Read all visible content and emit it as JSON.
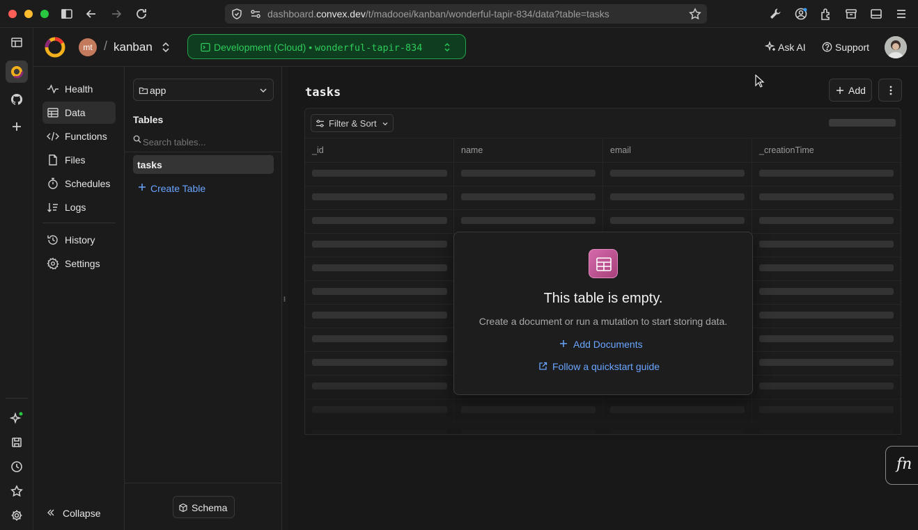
{
  "browser": {
    "url_prefix": "dashboard.",
    "url_domain": "convex.dev",
    "url_path": "/t/madooei/kanban/wonderful-tapir-834/data?table=tasks"
  },
  "header": {
    "team_avatar": "mt",
    "separator": "/",
    "project_name": "kanban",
    "env_label": "Development (Cloud)",
    "env_dot": "•",
    "deployment_name": "wonderful-tapir-834",
    "ask_ai": "Ask AI",
    "support": "Support"
  },
  "nav": {
    "items": [
      {
        "label": "Health",
        "icon": "pulse-icon"
      },
      {
        "label": "Data",
        "icon": "table-icon",
        "active": true
      },
      {
        "label": "Functions",
        "icon": "code-icon"
      },
      {
        "label": "Files",
        "icon": "file-icon"
      },
      {
        "label": "Schedules",
        "icon": "stopwatch-icon"
      },
      {
        "label": "Logs",
        "icon": "logs-icon"
      },
      {
        "label": "History",
        "icon": "history-icon"
      },
      {
        "label": "Settings",
        "icon": "gear-icon"
      }
    ],
    "collapse": "Collapse"
  },
  "tables_panel": {
    "component": "app",
    "heading": "Tables",
    "search_placeholder": "Search tables...",
    "tables": [
      "tasks"
    ],
    "create_table": "Create Table",
    "schema": "Schema"
  },
  "main": {
    "table_title": "tasks",
    "add_label": "Add",
    "filter_label": "Filter & Sort",
    "columns": [
      "_id",
      "name",
      "email",
      "_creationTime"
    ],
    "empty": {
      "title": "This table is empty.",
      "subtitle": "Create a document or run a mutation to start storing data.",
      "add_documents": "Add Documents",
      "quickstart": "Follow a quickstart guide"
    },
    "fn_label": "fn"
  },
  "colors": {
    "env_green": "#22c55e",
    "link_blue": "#6aa5ff",
    "empty_icon_pink": "#c9589a"
  }
}
